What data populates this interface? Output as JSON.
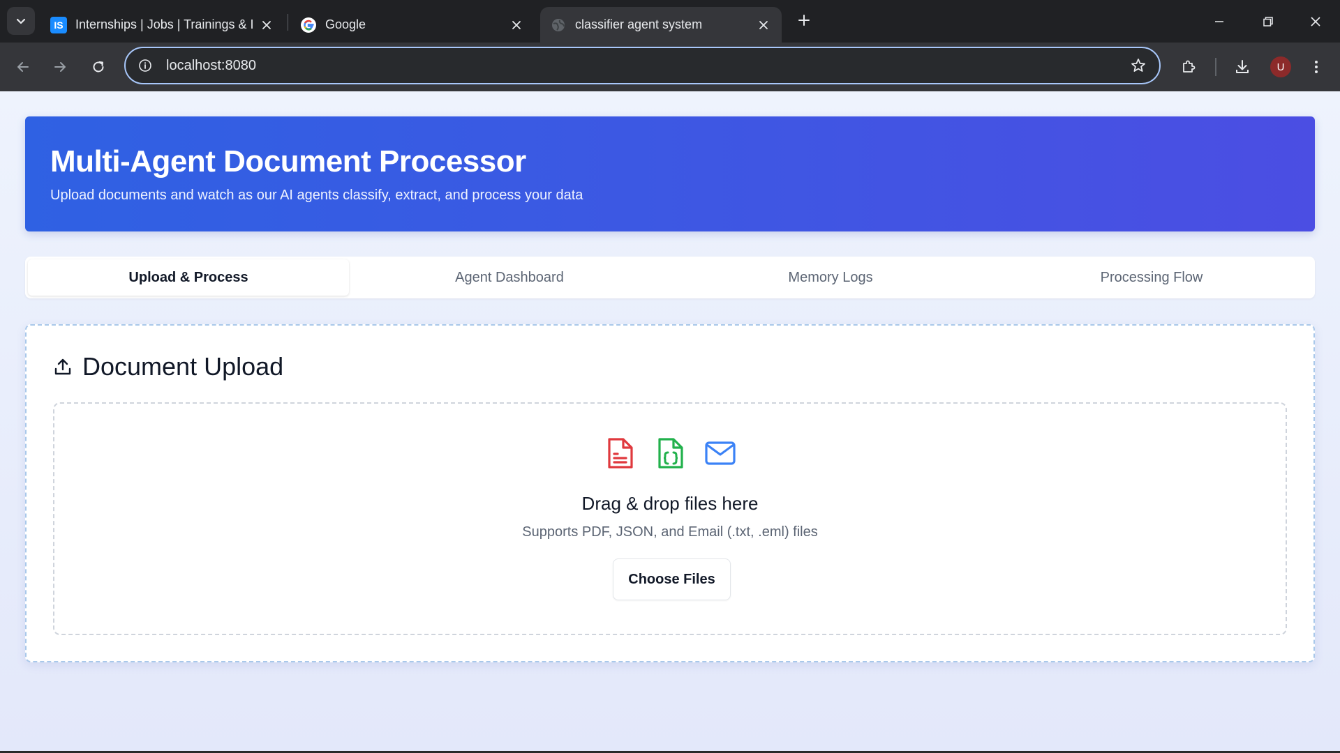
{
  "browser": {
    "tabs": [
      {
        "title": "Internships | Jobs | Trainings & I",
        "favicon": "internshala-icon",
        "active": false
      },
      {
        "title": "Google",
        "favicon": "google-icon",
        "active": false
      },
      {
        "title": "classifier agent system",
        "favicon": "globe-icon",
        "active": true
      }
    ],
    "favicon_is_text": "IS",
    "address": "localhost:8080",
    "profile_initial": "U"
  },
  "hero": {
    "title": "Multi-Agent Document Processor",
    "subtitle": "Upload documents and watch as our AI agents classify, extract, and process your data"
  },
  "nav_tabs": [
    {
      "label": "Upload & Process",
      "active": true
    },
    {
      "label": "Agent Dashboard",
      "active": false
    },
    {
      "label": "Memory Logs",
      "active": false
    },
    {
      "label": "Processing Flow",
      "active": false
    }
  ],
  "upload": {
    "heading": "Document Upload",
    "drop_title": "Drag & drop files here",
    "drop_subtitle": "Supports PDF, JSON, and Email (.txt, .eml) files",
    "choose_button": "Choose Files",
    "file_icons": [
      "pdf-file-icon",
      "json-file-icon",
      "mail-icon"
    ]
  },
  "colors": {
    "hero_start": "#2f61e3",
    "hero_end": "#4b4ee3",
    "pdf_icon": "#e0393e",
    "json_icon": "#22b14c",
    "mail_icon": "#3b82f6"
  }
}
